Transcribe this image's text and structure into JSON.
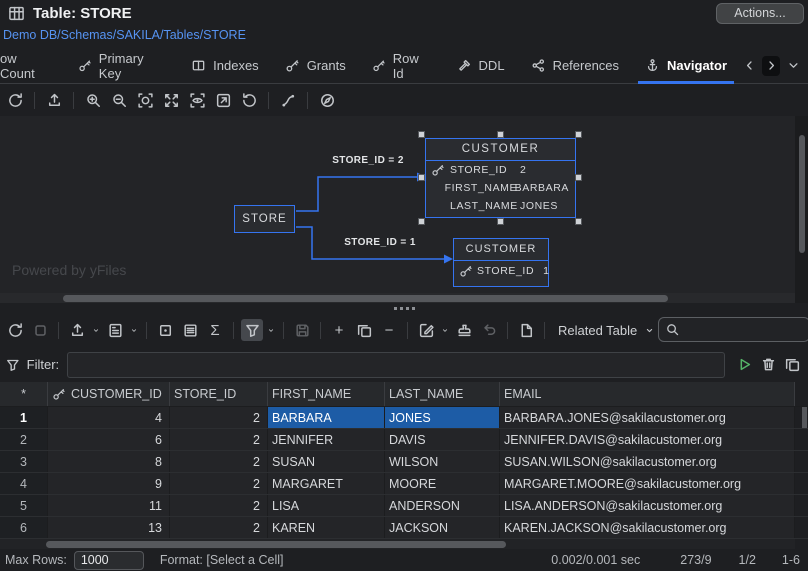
{
  "header": {
    "title": "Table: STORE",
    "breadcrumb": "Demo DB/Schemas/SAKILA/Tables/STORE",
    "actions_label": "Actions...",
    "icon": "table-icon"
  },
  "tabs": [
    {
      "label": "ow Count",
      "icon": ""
    },
    {
      "label": "Primary Key",
      "icon": "key-icon"
    },
    {
      "label": "Indexes",
      "icon": "columns-icon"
    },
    {
      "label": "Grants",
      "icon": "key-icon"
    },
    {
      "label": "Row Id",
      "icon": "key-icon"
    },
    {
      "label": "DDL",
      "icon": "hammer-icon"
    },
    {
      "label": "References",
      "icon": "share-icon"
    },
    {
      "label": "Navigator",
      "icon": "anchor-icon",
      "active": true
    }
  ],
  "tab_scrollers": [
    "chevron-left-icon",
    "chevron-right-icon",
    "chevron-down-icon"
  ],
  "diagram_toolbar_icons": [
    "refresh-icon",
    "export-icon",
    "zoom-in-icon",
    "zoom-out-icon",
    "zoom-selection-icon",
    "fit-screen-icon",
    "view-focus-icon",
    "open-external-icon",
    "reset-view-icon",
    "edge-routing-icon",
    "compass-icon"
  ],
  "diagram": {
    "store_label": "STORE",
    "customer_top": {
      "title": "CUSTOMER",
      "rows": [
        {
          "name": "STORE_ID",
          "value": "2",
          "key": true
        },
        {
          "name": "FIRST_NAME",
          "value": "BARBARA",
          "key": false
        },
        {
          "name": "LAST_NAME",
          "value": "JONES",
          "key": false
        }
      ]
    },
    "customer_bottom": {
      "title": "CUSTOMER",
      "rows": [
        {
          "name": "STORE_ID",
          "value": "1",
          "key": true
        }
      ]
    },
    "edge1_label": "STORE_ID = 2",
    "edge2_label": "STORE_ID = 1",
    "watermark": "Powered by yFiles",
    "edge_color": "#3574f0",
    "entity_border_color": "#3574f0"
  },
  "results_toolbar": {
    "icons": [
      "refresh-icon",
      "stop-icon",
      "export-icon",
      "report-icon",
      "cell-value-icon",
      "record-mode-icon",
      "sigma-icon",
      "filter-funnel-icon",
      "save-icon",
      "add-row-icon",
      "duplicate-row-icon",
      "delete-row-icon",
      "edit-icon",
      "apply-icon",
      "undo-icon",
      "new-document-icon",
      "search-icon"
    ],
    "related_table_label": "Related Table",
    "search_value": ""
  },
  "filter": {
    "label": "Filter:",
    "value": "",
    "action_icons": [
      "execute-icon",
      "delete-filter-icon",
      "copy-icon"
    ]
  },
  "grid": {
    "rownum_header": "*",
    "columns": [
      "CUSTOMER_ID",
      "STORE_ID",
      "FIRST_NAME",
      "LAST_NAME",
      "EMAIL"
    ],
    "rows": [
      {
        "num": "1",
        "customer_id": "4",
        "store_id": "2",
        "first_name": "BARBARA",
        "last_name": "JONES",
        "email": "BARBARA.JONES@sakilacustomer.org"
      },
      {
        "num": "2",
        "customer_id": "6",
        "store_id": "2",
        "first_name": "JENNIFER",
        "last_name": "DAVIS",
        "email": "JENNIFER.DAVIS@sakilacustomer.org"
      },
      {
        "num": "3",
        "customer_id": "8",
        "store_id": "2",
        "first_name": "SUSAN",
        "last_name": "WILSON",
        "email": "SUSAN.WILSON@sakilacustomer.org"
      },
      {
        "num": "4",
        "customer_id": "9",
        "store_id": "2",
        "first_name": "MARGARET",
        "last_name": "MOORE",
        "email": "MARGARET.MOORE@sakilacustomer.org"
      },
      {
        "num": "5",
        "customer_id": "11",
        "store_id": "2",
        "first_name": "LISA",
        "last_name": "ANDERSON",
        "email": "LISA.ANDERSON@sakilacustomer.org"
      },
      {
        "num": "6",
        "customer_id": "13",
        "store_id": "2",
        "first_name": "KAREN",
        "last_name": "JACKSON",
        "email": "KAREN.JACKSON@sakilacustomer.org"
      }
    ],
    "selection_color": "#1d5ca6"
  },
  "status_bar": {
    "max_rows_label": "Max Rows:",
    "max_rows_value": "1000",
    "format_label": "Format: [Select a Cell]",
    "timing": "0.002/0.001 sec",
    "counts": "273/9",
    "page": "1/2",
    "range": "1-6"
  }
}
